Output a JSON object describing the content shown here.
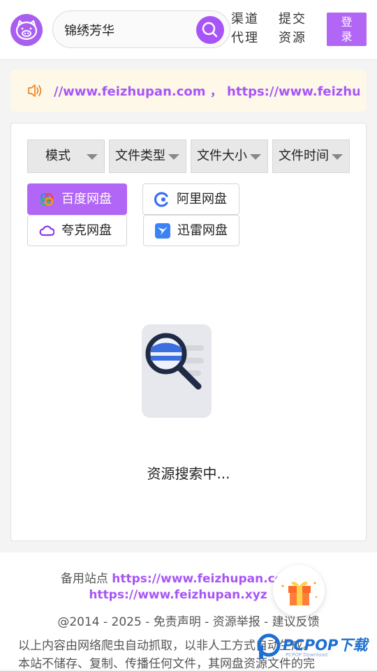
{
  "header": {
    "search_value": "锦绣芳华",
    "nav": [
      {
        "line1": "渠道",
        "line2": "代理"
      },
      {
        "line1": "提交",
        "line2": "资源"
      }
    ],
    "login_label_1": "登",
    "login_label_2": "录"
  },
  "notice": {
    "text": "//www.feizhupan.com ， https://www.feizhupan.xyz"
  },
  "filters": [
    {
      "label": "模式"
    },
    {
      "label": "文件类型"
    },
    {
      "label": "文件大小"
    },
    {
      "label": "文件时间"
    }
  ],
  "disks": [
    {
      "label": "百度网盘",
      "icon": "baidu-pan-icon",
      "active": true
    },
    {
      "label": "阿里网盘",
      "icon": "aliyun-pan-icon",
      "active": false
    },
    {
      "label": "夸克网盘",
      "icon": "quark-pan-icon",
      "active": false
    },
    {
      "label": "迅雷网盘",
      "icon": "xunlei-pan-icon",
      "active": false
    }
  ],
  "status_text": "资源搜索中...",
  "footer": {
    "backup_label": "备用站点",
    "backup_link_1": "https://www.feizhupan.com",
    "backup_link_2": "https://www.feizhupan.xyz",
    "copyright": "@2014 - 2025 - 免责声明 - 资源举报 - 建议反馈",
    "disclaimer_1": "以上内容由网络爬虫自动抓取，以非人工方式自动生成。",
    "disclaimer_2": "本站不储存、复制、传播任何文件，其网盘资源文件的完"
  },
  "watermark": {
    "brand": "PCPOP下载",
    "sub": "PCPOP Download"
  },
  "colors": {
    "accent": "#a855f7",
    "notice_bg": "#fdf8e8"
  }
}
